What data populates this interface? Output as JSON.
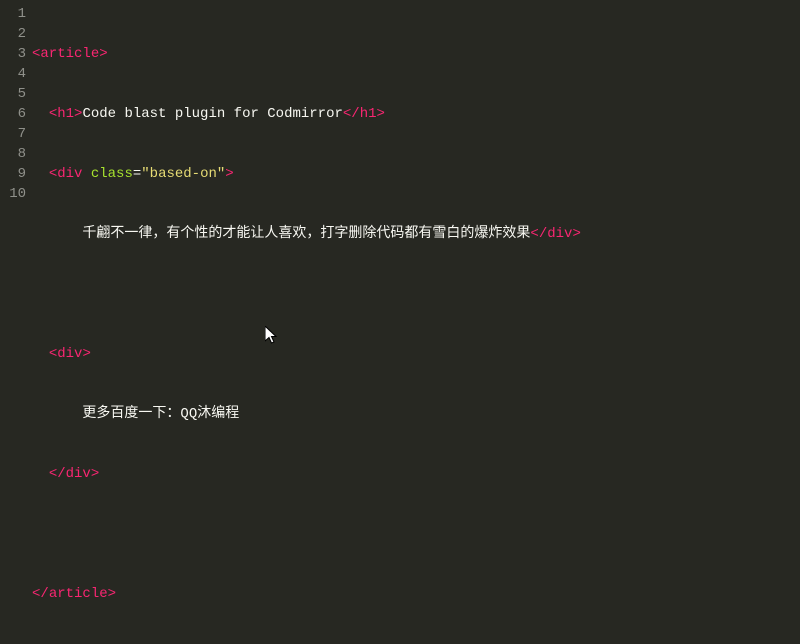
{
  "gutter": {
    "1": "1",
    "2": "2",
    "3": "3",
    "4": "4",
    "5": "5",
    "6": "6",
    "7": "7",
    "8": "8",
    "9": "9",
    "10": "10"
  },
  "tokens": {
    "lt": "<",
    "gt": ">",
    "lt_close": "</",
    "eq": "=",
    "article": "article",
    "h1": "h1",
    "div": "div",
    "class_attr": "class",
    "based_on_val": "\"based-on\"",
    "h1_text": "Code blast plugin for Codmirror",
    "line4_text": "千翩不一律，有个性的才能让人喜欢，打字删除代码都有雪白的爆炸效果",
    "line7_text": "更多百度一下：QQ沐编程",
    "indent1": "  ",
    "indent3": "      "
  }
}
